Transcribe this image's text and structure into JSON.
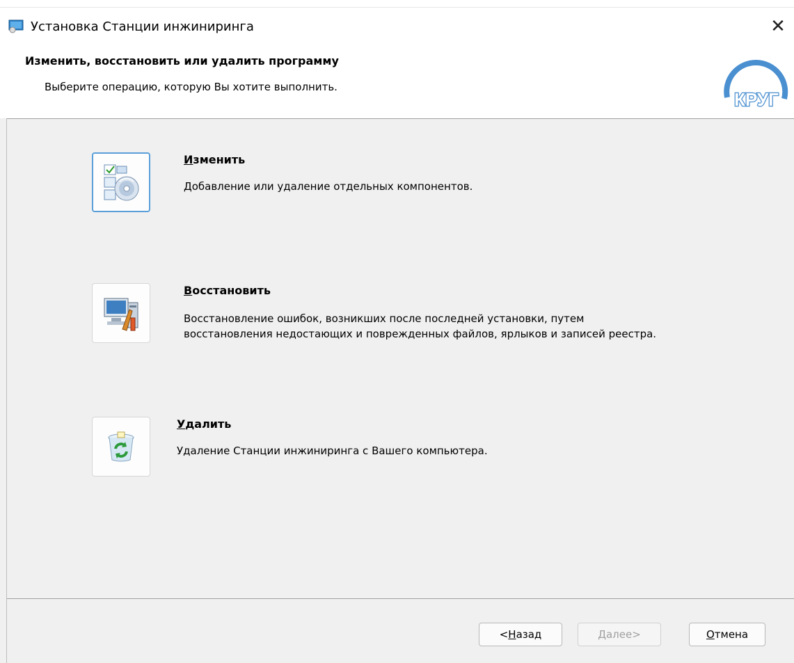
{
  "window": {
    "title": "Установка Станции инжиниринга",
    "close_glyph": "✕"
  },
  "header": {
    "heading": "Изменить, восстановить или удалить программу",
    "subheading": "Выберите операцию, которую Вы хотите выполнить.",
    "logo_text": "КРУГ",
    "logo_color": "#4a8fd0"
  },
  "options": [
    {
      "key": "И",
      "rest": "зменить",
      "description": [
        "Добавление или удаление отдельных компонентов."
      ],
      "icon": "modify-icon"
    },
    {
      "key": "В",
      "rest": "осстановить",
      "description": [
        "Восстановление ошибок, возникших после последней установки, путем",
        "восстановления недостающих и поврежденных файлов, ярлыков и записей реестра."
      ],
      "icon": "repair-icon"
    },
    {
      "key": "У",
      "rest": "далить",
      "description": [
        "Удаление Станции инжиниринга с Вашего компьютера."
      ],
      "icon": "recycle-bin-icon"
    }
  ],
  "footer": {
    "back": {
      "prefix": "< ",
      "key": "Н",
      "rest": "азад"
    },
    "next": {
      "key": "Д",
      "rest": "алее",
      "suffix": " >"
    },
    "cancel": {
      "key": "О",
      "rest": "тмена"
    }
  }
}
